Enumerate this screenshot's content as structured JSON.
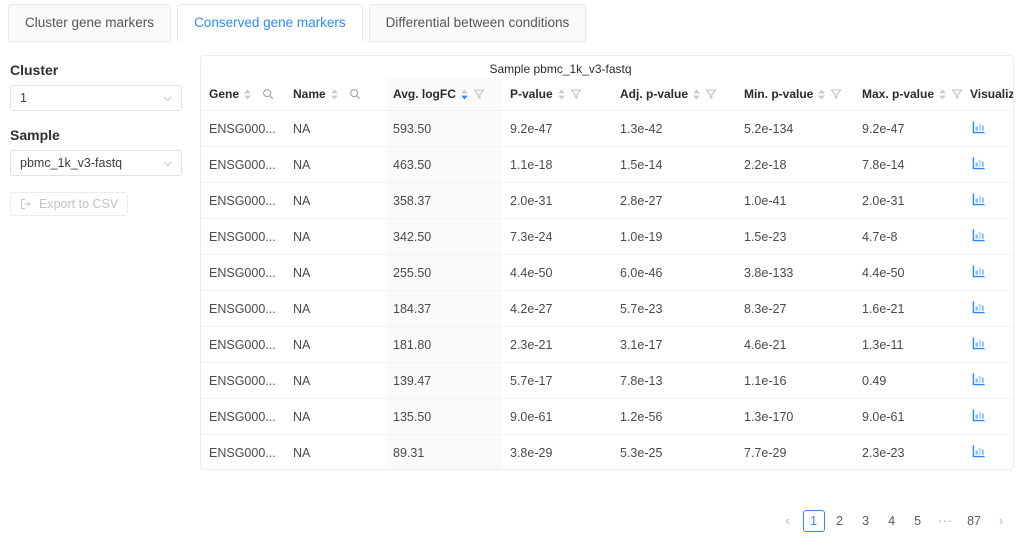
{
  "tabs": [
    {
      "label": "Cluster gene markers",
      "active": false
    },
    {
      "label": "Conserved gene markers",
      "active": true
    },
    {
      "label": "Differential between conditions",
      "active": false
    }
  ],
  "sidebar": {
    "cluster_label": "Cluster",
    "cluster_value": "1",
    "sample_label": "Sample",
    "sample_value": "pbmc_1k_v3-fastq",
    "export_label": "Export to CSV"
  },
  "table": {
    "group_header": "Sample pbmc_1k_v3-fastq",
    "columns": [
      {
        "key": "gene",
        "label": "Gene",
        "sortable": true,
        "searchable": true,
        "filterable": false,
        "sorted": false
      },
      {
        "key": "name",
        "label": "Name",
        "sortable": true,
        "searchable": true,
        "filterable": false,
        "sorted": false
      },
      {
        "key": "logfc",
        "label": "Avg. logFC",
        "sortable": true,
        "searchable": false,
        "filterable": true,
        "sorted": true
      },
      {
        "key": "pvalue",
        "label": "P-value",
        "sortable": true,
        "searchable": false,
        "filterable": true,
        "sorted": false
      },
      {
        "key": "adjp",
        "label": "Adj. p-value",
        "sortable": true,
        "searchable": false,
        "filterable": true,
        "sorted": false
      },
      {
        "key": "minp",
        "label": "Min. p-value",
        "sortable": true,
        "searchable": false,
        "filterable": true,
        "sorted": false
      },
      {
        "key": "maxp",
        "label": "Max. p-value",
        "sortable": true,
        "searchable": false,
        "filterable": true,
        "sorted": false
      },
      {
        "key": "viz",
        "label": "Visualize",
        "sortable": false,
        "searchable": false,
        "filterable": false,
        "sorted": false
      }
    ],
    "sort_direction": "desc",
    "rows": [
      {
        "gene": "ENSG000...",
        "name": "NA",
        "logfc": "593.50",
        "pvalue": "9.2e-47",
        "adjp": "1.3e-42",
        "minp": "5.2e-134",
        "maxp": "9.2e-47"
      },
      {
        "gene": "ENSG000...",
        "name": "NA",
        "logfc": "463.50",
        "pvalue": "1.1e-18",
        "adjp": "1.5e-14",
        "minp": "2.2e-18",
        "maxp": "7.8e-14"
      },
      {
        "gene": "ENSG000...",
        "name": "NA",
        "logfc": "358.37",
        "pvalue": "2.0e-31",
        "adjp": "2.8e-27",
        "minp": "1.0e-41",
        "maxp": "2.0e-31"
      },
      {
        "gene": "ENSG000...",
        "name": "NA",
        "logfc": "342.50",
        "pvalue": "7.3e-24",
        "adjp": "1.0e-19",
        "minp": "1.5e-23",
        "maxp": "4.7e-8"
      },
      {
        "gene": "ENSG000...",
        "name": "NA",
        "logfc": "255.50",
        "pvalue": "4.4e-50",
        "adjp": "6.0e-46",
        "minp": "3.8e-133",
        "maxp": "4.4e-50"
      },
      {
        "gene": "ENSG000...",
        "name": "NA",
        "logfc": "184.37",
        "pvalue": "4.2e-27",
        "adjp": "5.7e-23",
        "minp": "8.3e-27",
        "maxp": "1.6e-21"
      },
      {
        "gene": "ENSG000...",
        "name": "NA",
        "logfc": "181.80",
        "pvalue": "2.3e-21",
        "adjp": "3.1e-17",
        "minp": "4.6e-21",
        "maxp": "1.3e-11"
      },
      {
        "gene": "ENSG000...",
        "name": "NA",
        "logfc": "139.47",
        "pvalue": "5.7e-17",
        "adjp": "7.8e-13",
        "minp": "1.1e-16",
        "maxp": "0.49"
      },
      {
        "gene": "ENSG000...",
        "name": "NA",
        "logfc": "135.50",
        "pvalue": "9.0e-61",
        "adjp": "1.2e-56",
        "minp": "1.3e-170",
        "maxp": "9.0e-61"
      },
      {
        "gene": "ENSG000...",
        "name": "NA",
        "logfc": "89.31",
        "pvalue": "3.8e-29",
        "adjp": "5.3e-25",
        "minp": "7.7e-29",
        "maxp": "2.3e-23"
      }
    ]
  },
  "pagination": {
    "prev": "‹",
    "next": "›",
    "pages": [
      "1",
      "2",
      "3",
      "4",
      "5"
    ],
    "ellipsis": "···",
    "last": "87",
    "current": "1"
  },
  "colors": {
    "accent": "#2f8bfa",
    "text": "#4a4a4a",
    "border": "#ededed",
    "sorted_bg": "#fafafa"
  }
}
